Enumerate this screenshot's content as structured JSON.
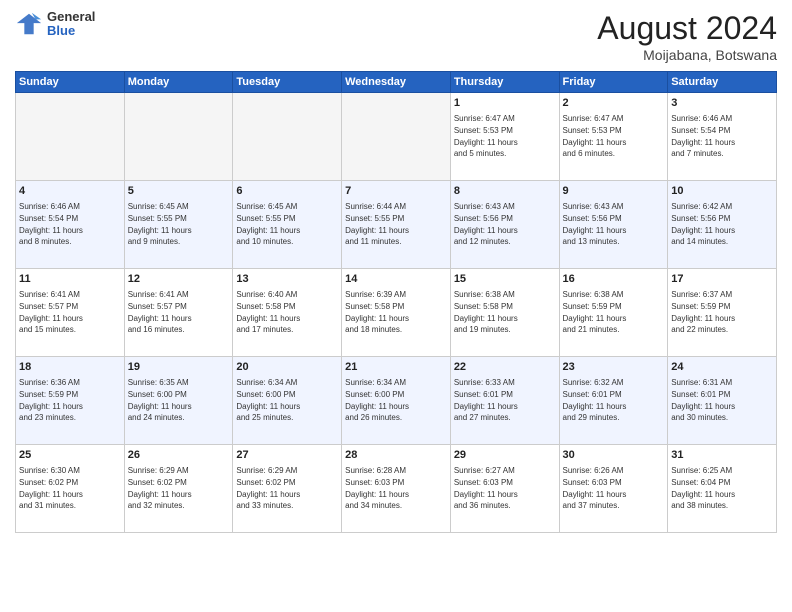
{
  "header": {
    "logo": {
      "general": "General",
      "blue": "Blue"
    },
    "month": "August 2024",
    "location": "Moijabana, Botswana"
  },
  "weekdays": [
    "Sunday",
    "Monday",
    "Tuesday",
    "Wednesday",
    "Thursday",
    "Friday",
    "Saturday"
  ],
  "weeks": [
    [
      {
        "day": "",
        "empty": true
      },
      {
        "day": "",
        "empty": true
      },
      {
        "day": "",
        "empty": true
      },
      {
        "day": "",
        "empty": true
      },
      {
        "day": "1",
        "sunrise": "Sunrise: 6:47 AM",
        "sunset": "Sunset: 5:53 PM",
        "daylight": "Daylight: 11 hours and 5 minutes."
      },
      {
        "day": "2",
        "sunrise": "Sunrise: 6:47 AM",
        "sunset": "Sunset: 5:53 PM",
        "daylight": "Daylight: 11 hours and 6 minutes."
      },
      {
        "day": "3",
        "sunrise": "Sunrise: 6:46 AM",
        "sunset": "Sunset: 5:54 PM",
        "daylight": "Daylight: 11 hours and 7 minutes."
      }
    ],
    [
      {
        "day": "4",
        "sunrise": "Sunrise: 6:46 AM",
        "sunset": "Sunset: 5:54 PM",
        "daylight": "Daylight: 11 hours and 8 minutes."
      },
      {
        "day": "5",
        "sunrise": "Sunrise: 6:45 AM",
        "sunset": "Sunset: 5:55 PM",
        "daylight": "Daylight: 11 hours and 9 minutes."
      },
      {
        "day": "6",
        "sunrise": "Sunrise: 6:45 AM",
        "sunset": "Sunset: 5:55 PM",
        "daylight": "Daylight: 11 hours and 10 minutes."
      },
      {
        "day": "7",
        "sunrise": "Sunrise: 6:44 AM",
        "sunset": "Sunset: 5:55 PM",
        "daylight": "Daylight: 11 hours and 11 minutes."
      },
      {
        "day": "8",
        "sunrise": "Sunrise: 6:43 AM",
        "sunset": "Sunset: 5:56 PM",
        "daylight": "Daylight: 11 hours and 12 minutes."
      },
      {
        "day": "9",
        "sunrise": "Sunrise: 6:43 AM",
        "sunset": "Sunset: 5:56 PM",
        "daylight": "Daylight: 11 hours and 13 minutes."
      },
      {
        "day": "10",
        "sunrise": "Sunrise: 6:42 AM",
        "sunset": "Sunset: 5:56 PM",
        "daylight": "Daylight: 11 hours and 14 minutes."
      }
    ],
    [
      {
        "day": "11",
        "sunrise": "Sunrise: 6:41 AM",
        "sunset": "Sunset: 5:57 PM",
        "daylight": "Daylight: 11 hours and 15 minutes."
      },
      {
        "day": "12",
        "sunrise": "Sunrise: 6:41 AM",
        "sunset": "Sunset: 5:57 PM",
        "daylight": "Daylight: 11 hours and 16 minutes."
      },
      {
        "day": "13",
        "sunrise": "Sunrise: 6:40 AM",
        "sunset": "Sunset: 5:58 PM",
        "daylight": "Daylight: 11 hours and 17 minutes."
      },
      {
        "day": "14",
        "sunrise": "Sunrise: 6:39 AM",
        "sunset": "Sunset: 5:58 PM",
        "daylight": "Daylight: 11 hours and 18 minutes."
      },
      {
        "day": "15",
        "sunrise": "Sunrise: 6:38 AM",
        "sunset": "Sunset: 5:58 PM",
        "daylight": "Daylight: 11 hours and 19 minutes."
      },
      {
        "day": "16",
        "sunrise": "Sunrise: 6:38 AM",
        "sunset": "Sunset: 5:59 PM",
        "daylight": "Daylight: 11 hours and 21 minutes."
      },
      {
        "day": "17",
        "sunrise": "Sunrise: 6:37 AM",
        "sunset": "Sunset: 5:59 PM",
        "daylight": "Daylight: 11 hours and 22 minutes."
      }
    ],
    [
      {
        "day": "18",
        "sunrise": "Sunrise: 6:36 AM",
        "sunset": "Sunset: 5:59 PM",
        "daylight": "Daylight: 11 hours and 23 minutes."
      },
      {
        "day": "19",
        "sunrise": "Sunrise: 6:35 AM",
        "sunset": "Sunset: 6:00 PM",
        "daylight": "Daylight: 11 hours and 24 minutes."
      },
      {
        "day": "20",
        "sunrise": "Sunrise: 6:34 AM",
        "sunset": "Sunset: 6:00 PM",
        "daylight": "Daylight: 11 hours and 25 minutes."
      },
      {
        "day": "21",
        "sunrise": "Sunrise: 6:34 AM",
        "sunset": "Sunset: 6:00 PM",
        "daylight": "Daylight: 11 hours and 26 minutes."
      },
      {
        "day": "22",
        "sunrise": "Sunrise: 6:33 AM",
        "sunset": "Sunset: 6:01 PM",
        "daylight": "Daylight: 11 hours and 27 minutes."
      },
      {
        "day": "23",
        "sunrise": "Sunrise: 6:32 AM",
        "sunset": "Sunset: 6:01 PM",
        "daylight": "Daylight: 11 hours and 29 minutes."
      },
      {
        "day": "24",
        "sunrise": "Sunrise: 6:31 AM",
        "sunset": "Sunset: 6:01 PM",
        "daylight": "Daylight: 11 hours and 30 minutes."
      }
    ],
    [
      {
        "day": "25",
        "sunrise": "Sunrise: 6:30 AM",
        "sunset": "Sunset: 6:02 PM",
        "daylight": "Daylight: 11 hours and 31 minutes."
      },
      {
        "day": "26",
        "sunrise": "Sunrise: 6:29 AM",
        "sunset": "Sunset: 6:02 PM",
        "daylight": "Daylight: 11 hours and 32 minutes."
      },
      {
        "day": "27",
        "sunrise": "Sunrise: 6:29 AM",
        "sunset": "Sunset: 6:02 PM",
        "daylight": "Daylight: 11 hours and 33 minutes."
      },
      {
        "day": "28",
        "sunrise": "Sunrise: 6:28 AM",
        "sunset": "Sunset: 6:03 PM",
        "daylight": "Daylight: 11 hours and 34 minutes."
      },
      {
        "day": "29",
        "sunrise": "Sunrise: 6:27 AM",
        "sunset": "Sunset: 6:03 PM",
        "daylight": "Daylight: 11 hours and 36 minutes."
      },
      {
        "day": "30",
        "sunrise": "Sunrise: 6:26 AM",
        "sunset": "Sunset: 6:03 PM",
        "daylight": "Daylight: 11 hours and 37 minutes."
      },
      {
        "day": "31",
        "sunrise": "Sunrise: 6:25 AM",
        "sunset": "Sunset: 6:04 PM",
        "daylight": "Daylight: 11 hours and 38 minutes."
      }
    ]
  ]
}
